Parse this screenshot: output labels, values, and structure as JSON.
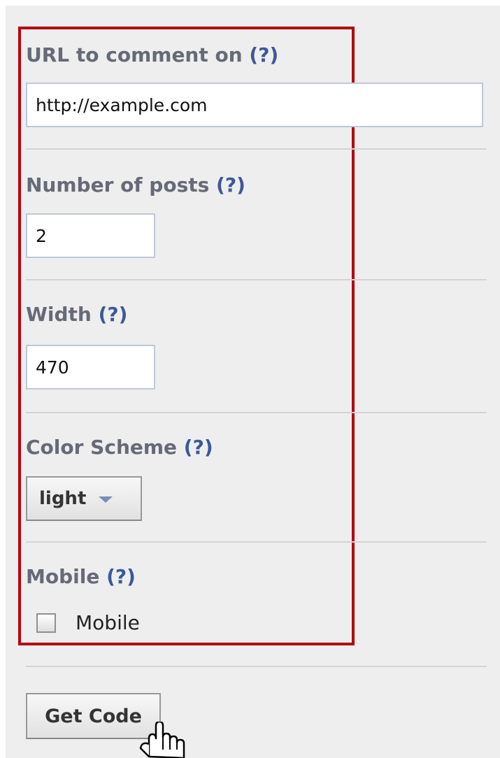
{
  "form": {
    "url": {
      "label": "URL to comment on",
      "help": "(?)",
      "value": "http://example.com"
    },
    "num_posts": {
      "label": "Number of posts",
      "help": "(?)",
      "value": "2"
    },
    "width": {
      "label": "Width",
      "help": "(?)",
      "value": "470"
    },
    "color_scheme": {
      "label": "Color Scheme",
      "help": "(?)",
      "selected": "light"
    },
    "mobile": {
      "label": "Mobile",
      "help": "(?)",
      "checkbox_label": "Mobile",
      "checked": false
    }
  },
  "actions": {
    "get_code_label": "Get Code"
  },
  "colors": {
    "panel_background": "#eeeeee",
    "highlight_border": "#b5000f",
    "label_text": "#666a78",
    "help_link": "#3b5998",
    "input_border": "#bdc7d8"
  },
  "icons": {
    "dropdown": "chevron-down-icon",
    "cursor": "hand-pointer-icon"
  }
}
